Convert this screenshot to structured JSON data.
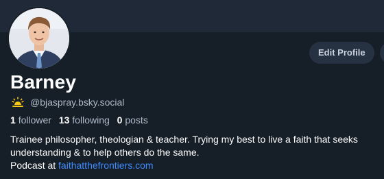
{
  "profile": {
    "display_name": "Barney",
    "handle": "@bjaspray.bsky.social",
    "edit_profile_label": "Edit Profile",
    "stats": {
      "followers_count": "1",
      "followers_label": "follower",
      "following_count": "13",
      "following_label": "following",
      "posts_count": "0",
      "posts_label": "posts"
    },
    "bio": {
      "text": "Trainee philosopher, theologian & teacher. Trying my best to live a faith that seeks understanding & to help others do the same.",
      "podcast_prefix": "Podcast at ",
      "podcast_link": "faithatthefrontiers.com"
    }
  },
  "icons": {
    "handle_badge": "sunrise-icon",
    "more": "more-options-icon"
  },
  "colors": {
    "background": "#161e27",
    "banner": "#1f2937",
    "button_bg": "#263241",
    "link": "#3f8cff",
    "muted_text": "#aebbc9",
    "sun_icon": "#f5c518"
  }
}
